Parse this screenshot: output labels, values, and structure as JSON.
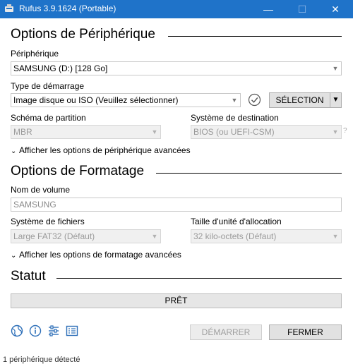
{
  "window": {
    "title": "Rufus 3.9.1624 (Portable)",
    "min_glyph": "—",
    "max_glyph": "☐",
    "close_glyph": "✕",
    "title_bar_color": "#1f73c9"
  },
  "device_section": {
    "heading": "Options de Périphérique",
    "device_label": "Périphérique",
    "device_value": "SAMSUNG (D:) [128 Go]",
    "boot_label": "Type de démarrage",
    "boot_value": "Image disque ou ISO (Veuillez sélectionner)",
    "select_button": "SÉLECTION",
    "partition_label": "Schéma de partition",
    "partition_value": "MBR",
    "target_label": "Système de destination",
    "target_value": "BIOS (ou UEFI-CSM)",
    "help_mark": "?",
    "advanced_toggle": "Afficher les options de périphérique avancées"
  },
  "format_section": {
    "heading": "Options de Formatage",
    "volume_label": "Nom de volume",
    "volume_value": "SAMSUNG",
    "fs_label": "Système de fichiers",
    "fs_value": "Large FAT32 (Défaut)",
    "cluster_label": "Taille d'unité d'allocation",
    "cluster_value": "32 kilo-octets (Défaut)",
    "advanced_toggle": "Afficher les options de formatage avancées"
  },
  "status_section": {
    "heading": "Statut",
    "status_text": "PRÊT"
  },
  "actions": {
    "start_button": "DÉMARRER",
    "close_button": "FERMER"
  },
  "icons": {
    "language": "globe-icon",
    "about": "info-icon",
    "settings": "sliders-icon",
    "log": "log-icon"
  },
  "footer": {
    "status_text": "1 périphérique détecté"
  }
}
